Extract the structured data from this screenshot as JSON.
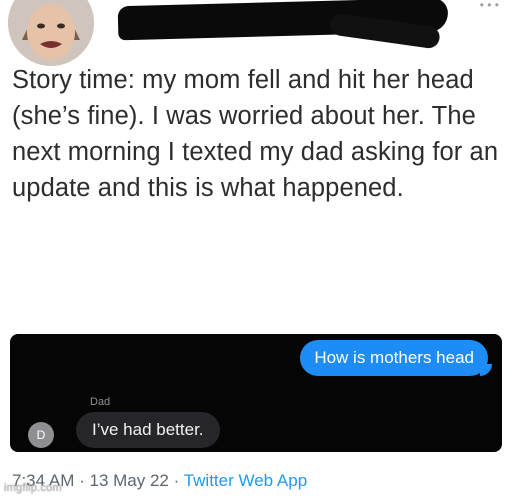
{
  "tweet": {
    "text": "Story time: my mom fell and hit her head (she’s fine). I was worried about her. The next morning I texted my dad asking for an update and this is what happened."
  },
  "chat": {
    "outgoing_message": "How is mothers head",
    "sender_name": "Dad",
    "sender_initial": "D",
    "incoming_message": "I’ve had better."
  },
  "meta": {
    "time": "7:34 AM",
    "separator": " · ",
    "date": "13 May 22",
    "app": "Twitter Web App"
  },
  "watermark": "imgflip.com",
  "colors": {
    "bubble_blue": "#1d8cf5",
    "link_blue": "#1d9bf0",
    "chat_background": "#050505"
  }
}
